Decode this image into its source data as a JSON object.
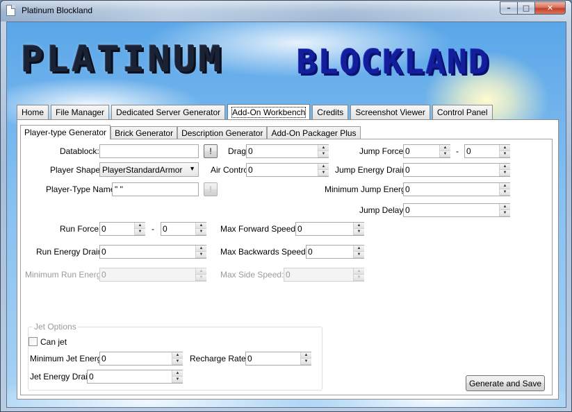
{
  "window": {
    "title": "Platinum Blockland",
    "minimize_label": "–",
    "maximize_label": "□",
    "close_label": "✕"
  },
  "logo": {
    "left_text": "PLATINUM",
    "right_text": "BLOCKLAND"
  },
  "main_tabs": [
    {
      "label": "Home",
      "active": false
    },
    {
      "label": "File Manager",
      "active": false
    },
    {
      "label": "Dedicated Server Generator",
      "active": false
    },
    {
      "label": "Add-On Workbench",
      "active": true
    },
    {
      "label": "Credits",
      "active": false
    },
    {
      "label": "Screenshot Viewer",
      "active": false
    },
    {
      "label": "Control Panel",
      "active": false
    }
  ],
  "sub_tabs": [
    {
      "label": "Player-type Generator",
      "active": true
    },
    {
      "label": "Brick Generator",
      "active": false
    },
    {
      "label": "Description Generator",
      "active": false
    },
    {
      "label": "Add-On Packager Plus",
      "active": false
    }
  ],
  "form": {
    "datablock_label": "Datablock:",
    "datablock_value": "",
    "bang_label": "!",
    "player_shape_label": "Player Shape:",
    "player_shape_value": "PlayerStandardArmor",
    "player_type_name_label": "Player-Type Name:",
    "player_type_name_value": "\" \"",
    "drag_label": "Drag:",
    "drag_value": "0",
    "air_control_label": "Air Control:",
    "air_control_value": "0",
    "jump_force_label": "Jump Force:",
    "jump_force_min": "0",
    "jump_force_dash": "-",
    "jump_force_max": "0",
    "jump_energy_drain_label": "Jump Energy Drain:",
    "jump_energy_drain_value": "0",
    "min_jump_energy_label": "Minimum Jump Energy:",
    "min_jump_energy_value": "0",
    "jump_delay_label": "Jump Delay:",
    "jump_delay_value": "0",
    "run_force_label": "Run Force:",
    "run_force_min": "0",
    "run_force_dash": "-",
    "run_force_max": "0",
    "run_energy_drain_label": "Run Energy Drain:",
    "run_energy_drain_value": "0",
    "min_run_energy_label": "Minimum Run Energy:",
    "min_run_energy_value": "0",
    "max_forward_speed_label": "Max Forward Speed:",
    "max_forward_speed_value": "0",
    "max_backwards_speed_label": "Max Backwards Speed:",
    "max_backwards_speed_value": "0",
    "max_side_speed_label": "Max Side Speed:",
    "max_side_speed_value": "0"
  },
  "jet": {
    "group_label": "Jet Options",
    "can_jet_label": "Can jet",
    "can_jet_checked": false,
    "min_jet_energy_label": "Minimum Jet Energy:",
    "min_jet_energy_value": "0",
    "recharge_rate_label": "Recharge Rate:",
    "recharge_rate_value": "0",
    "jet_energy_drain_label": "Jet Energy Drain:",
    "jet_energy_drain_value": "0"
  },
  "actions": {
    "generate_label": "Generate and Save"
  },
  "spin_up": "▲",
  "spin_down": "▼",
  "dropdown_arrow": "▼"
}
